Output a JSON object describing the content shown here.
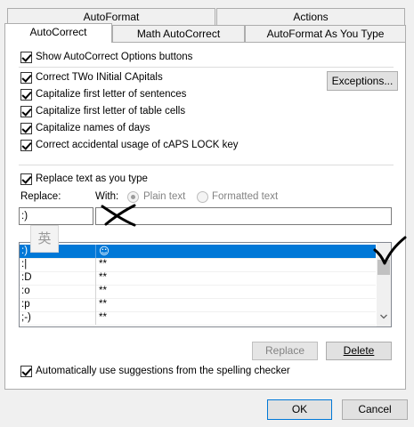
{
  "tabs": {
    "row1": [
      "AutoFormat",
      "Actions"
    ],
    "row2": [
      "AutoCorrect",
      "Math AutoCorrect",
      "AutoFormat As You Type"
    ]
  },
  "checks": {
    "show_buttons": {
      "label": "Show AutoCorrect Options buttons",
      "checked": true
    },
    "two_initials": {
      "label": "Correct TWo INitial CApitals",
      "checked": true
    },
    "first_sentence": {
      "label": "Capitalize first letter of sentences",
      "checked": true
    },
    "first_cell": {
      "label": "Capitalize first letter of table cells",
      "checked": true
    },
    "days": {
      "label": "Capitalize names of days",
      "checked": true
    },
    "caps_lock": {
      "label": "Correct accidental usage of cAPS LOCK key",
      "checked": true
    },
    "replace_text": {
      "label": "Replace text as you type",
      "checked": true
    },
    "spelling": {
      "label": "Automatically use suggestions from the spelling checker",
      "checked": true
    }
  },
  "buttons": {
    "exceptions": "Exceptions...",
    "replace": "Replace",
    "delete": "Delete",
    "ok": "OK",
    "cancel": "Cancel"
  },
  "replace_section": {
    "replace_label": "Replace:",
    "with_label": "With:",
    "plain_text": "Plain text",
    "formatted_text": "Formatted text",
    "replace_value": ":)",
    "with_value": "",
    "ime_glyph": "英"
  },
  "entries": [
    {
      "replace": ":)",
      "with": "☺",
      "selected": true
    },
    {
      "replace": ":|",
      "with": "**"
    },
    {
      "replace": ":D",
      "with": "**"
    },
    {
      "replace": ":o",
      "with": "**"
    },
    {
      "replace": ":p",
      "with": "**"
    },
    {
      "replace": ";-)",
      "with": "**"
    }
  ]
}
